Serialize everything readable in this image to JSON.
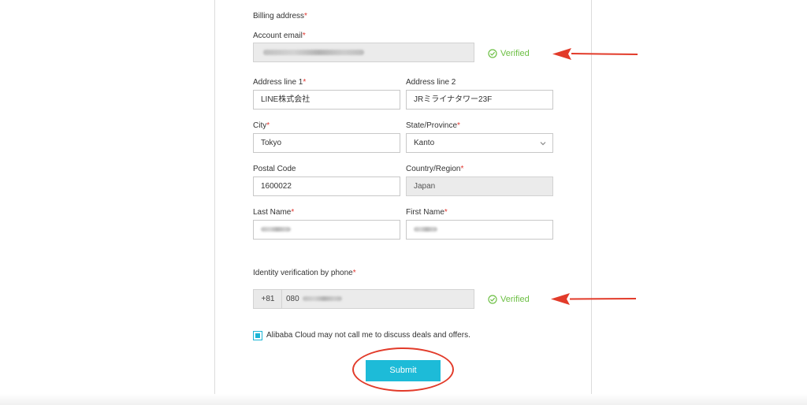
{
  "form": {
    "billing_address_label": "Billing address",
    "account_email": {
      "label": "Account email",
      "status": "Verified"
    },
    "address_line1": {
      "label": "Address line 1",
      "value": "LINE株式会社"
    },
    "address_line2": {
      "label": "Address line 2",
      "value": "JRミライナタワー23F"
    },
    "city": {
      "label": "City",
      "value": "Tokyo"
    },
    "state": {
      "label": "State/Province",
      "value": "Kanto"
    },
    "postal_code": {
      "label": "Postal Code",
      "value": "1600022"
    },
    "country": {
      "label": "Country/Region",
      "value": "Japan"
    },
    "last_name": {
      "label": "Last Name"
    },
    "first_name": {
      "label": "First Name"
    },
    "phone": {
      "label": "Identity verification by phone",
      "prefix": "+81",
      "value_visible": "080",
      "status": "Verified"
    },
    "opt_out_label": "Alibaba Cloud may not call me to discuss deals and offers.",
    "submit_label": "Submit",
    "required_mark": "*"
  },
  "colors": {
    "accent": "#1dbbd8",
    "verified": "#6cbf43",
    "required": "#e0342e",
    "annotation": "#e23b2a"
  }
}
